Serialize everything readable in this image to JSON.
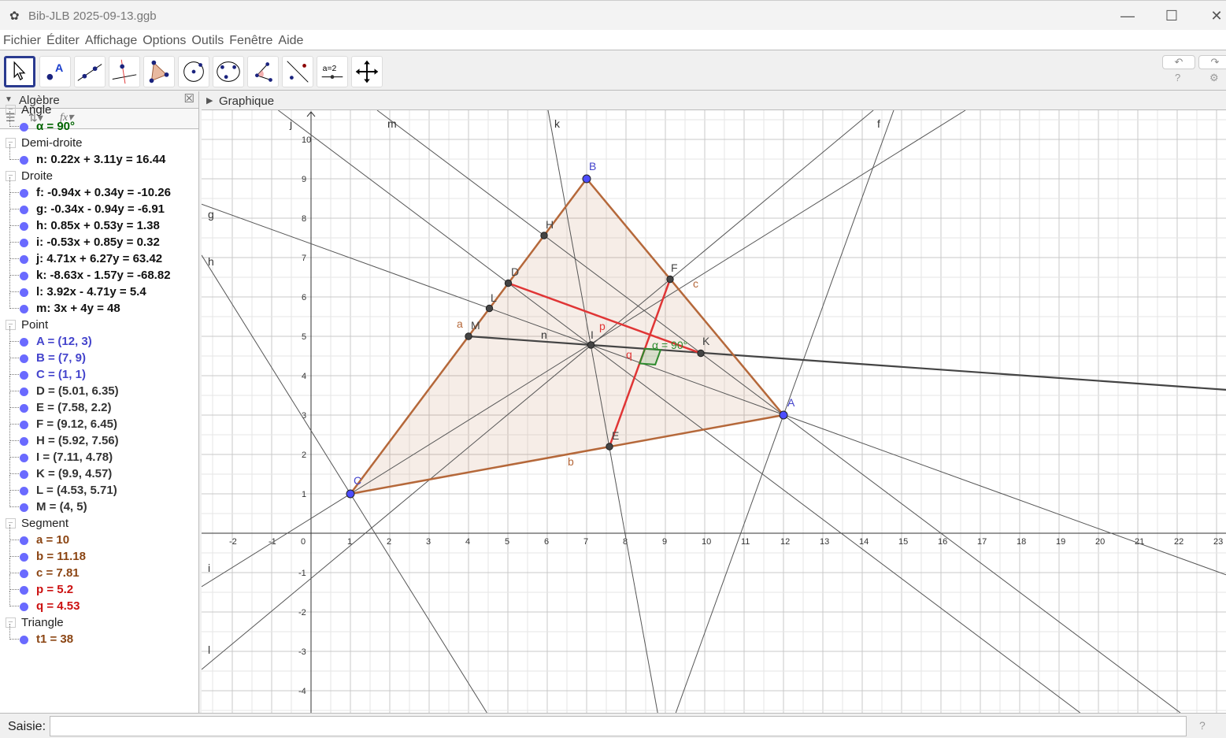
{
  "window": {
    "title": "Bib-JLB 2025-09-13.ggb",
    "minimize": "—",
    "maximize": "☐",
    "close": "✕"
  },
  "menu": [
    "Fichier",
    "Éditer",
    "Affichage",
    "Options",
    "Outils",
    "Fenêtre",
    "Aide"
  ],
  "tools": [
    "move",
    "point",
    "line",
    "perpendicular",
    "polygon",
    "circle-center",
    "circle-3points",
    "angle",
    "reflect",
    "slider",
    "move-view"
  ],
  "toolbar_right": {
    "undo": "↶",
    "redo": "↷",
    "help": "?",
    "settings": "⚙"
  },
  "algebra": {
    "title": "Algèbre",
    "categories": [
      {
        "name": "Angle",
        "items": [
          {
            "text": "α = 90°",
            "color": "#006400"
          }
        ]
      },
      {
        "name": "Demi-droite",
        "items": [
          {
            "text": "n: 0.22x + 3.11y = 16.44",
            "color": "#111111"
          }
        ]
      },
      {
        "name": "Droite",
        "items": [
          {
            "text": "f: -0.94x + 0.34y = -10.26",
            "color": "#111111"
          },
          {
            "text": "g: -0.34x - 0.94y = -6.91",
            "color": "#111111"
          },
          {
            "text": "h: 0.85x + 0.53y = 1.38",
            "color": "#111111"
          },
          {
            "text": "i: -0.53x + 0.85y = 0.32",
            "color": "#111111"
          },
          {
            "text": "j: 4.71x + 6.27y = 63.42",
            "color": "#111111"
          },
          {
            "text": "k: -8.63x - 1.57y = -68.82",
            "color": "#111111"
          },
          {
            "text": "l: 3.92x - 4.71y = 5.4",
            "color": "#111111"
          },
          {
            "text": "m: 3x + 4y = 48",
            "color": "#111111"
          }
        ]
      },
      {
        "name": "Point",
        "items": [
          {
            "text": "A = (12, 3)",
            "color": "#4444cc"
          },
          {
            "text": "B = (7, 9)",
            "color": "#4444cc"
          },
          {
            "text": "C = (1, 1)",
            "color": "#4444cc"
          },
          {
            "text": "D = (5.01, 6.35)",
            "color": "#333333"
          },
          {
            "text": "E = (7.58, 2.2)",
            "color": "#333333"
          },
          {
            "text": "F = (9.12, 6.45)",
            "color": "#333333"
          },
          {
            "text": "H = (5.92, 7.56)",
            "color": "#333333"
          },
          {
            "text": "I = (7.11, 4.78)",
            "color": "#333333"
          },
          {
            "text": "K = (9.9, 4.57)",
            "color": "#333333"
          },
          {
            "text": "L = (4.53, 5.71)",
            "color": "#333333"
          },
          {
            "text": "M = (4, 5)",
            "color": "#333333"
          }
        ]
      },
      {
        "name": "Segment",
        "items": [
          {
            "text": "a = 10",
            "color": "#8b4513"
          },
          {
            "text": "b = 11.18",
            "color": "#8b4513"
          },
          {
            "text": "c = 7.81",
            "color": "#8b4513"
          },
          {
            "text": "p = 5.2",
            "color": "#cc1111"
          },
          {
            "text": "q = 4.53",
            "color": "#cc1111"
          }
        ]
      },
      {
        "name": "Triangle",
        "items": [
          {
            "text": "t1 = 38",
            "color": "#8b4513"
          }
        ]
      }
    ]
  },
  "graphics": {
    "title": "Graphique",
    "lines": [
      {
        "name": "f",
        "a": -0.94,
        "b": 0.34,
        "c": -10.26
      },
      {
        "name": "g",
        "a": -0.34,
        "b": -0.94,
        "c": -6.91
      },
      {
        "name": "h",
        "a": 0.85,
        "b": 0.53,
        "c": 1.38
      },
      {
        "name": "i",
        "a": -0.53,
        "b": 0.85,
        "c": 0.32
      },
      {
        "name": "j",
        "a": 4.71,
        "b": 6.27,
        "c": 63.42
      },
      {
        "name": "k",
        "a": -8.63,
        "b": -1.57,
        "c": -68.82
      },
      {
        "name": "l",
        "a": 3.92,
        "b": -4.71,
        "c": 5.4
      },
      {
        "name": "m",
        "a": 3,
        "b": 4,
        "c": 48
      }
    ],
    "ray": {
      "name": "n",
      "a": 0.22,
      "b": 3.11,
      "c": 16.44,
      "start": [
        4,
        5
      ]
    },
    "points": [
      {
        "name": "A",
        "x": 12,
        "y": 3,
        "free": true
      },
      {
        "name": "B",
        "x": 7,
        "y": 9,
        "free": true
      },
      {
        "name": "C",
        "x": 1,
        "y": 1,
        "free": true
      },
      {
        "name": "D",
        "x": 5.01,
        "y": 6.35
      },
      {
        "name": "E",
        "x": 7.58,
        "y": 2.2
      },
      {
        "name": "F",
        "x": 9.12,
        "y": 6.45
      },
      {
        "name": "H",
        "x": 5.92,
        "y": 7.56
      },
      {
        "name": "I",
        "x": 7.11,
        "y": 4.78
      },
      {
        "name": "K",
        "x": 9.9,
        "y": 4.57
      },
      {
        "name": "L",
        "x": 4.53,
        "y": 5.71
      },
      {
        "name": "M",
        "x": 4,
        "y": 5
      }
    ],
    "segments": [
      {
        "name": "a",
        "from": "C",
        "to": "B",
        "color": "#b5683a"
      },
      {
        "name": "b",
        "from": "C",
        "to": "A",
        "color": "#b5683a"
      },
      {
        "name": "c",
        "from": "B",
        "to": "A",
        "color": "#b5683a"
      },
      {
        "name": "p",
        "from": "D",
        "to": "K",
        "color": "#e03535"
      },
      {
        "name": "q",
        "from": "E",
        "to": "F",
        "color": "#e03535"
      }
    ],
    "triangle": {
      "name": "t1",
      "vertices": [
        "A",
        "B",
        "C"
      ],
      "fill": "#b5683a"
    },
    "angle": {
      "label": "α = 90°",
      "color": "#2e8b2e"
    },
    "xrange": [
      -2,
      23
    ],
    "yrange": [
      -4,
      10
    ]
  },
  "input": {
    "label": "Saisie:",
    "value": "",
    "help": "?"
  }
}
